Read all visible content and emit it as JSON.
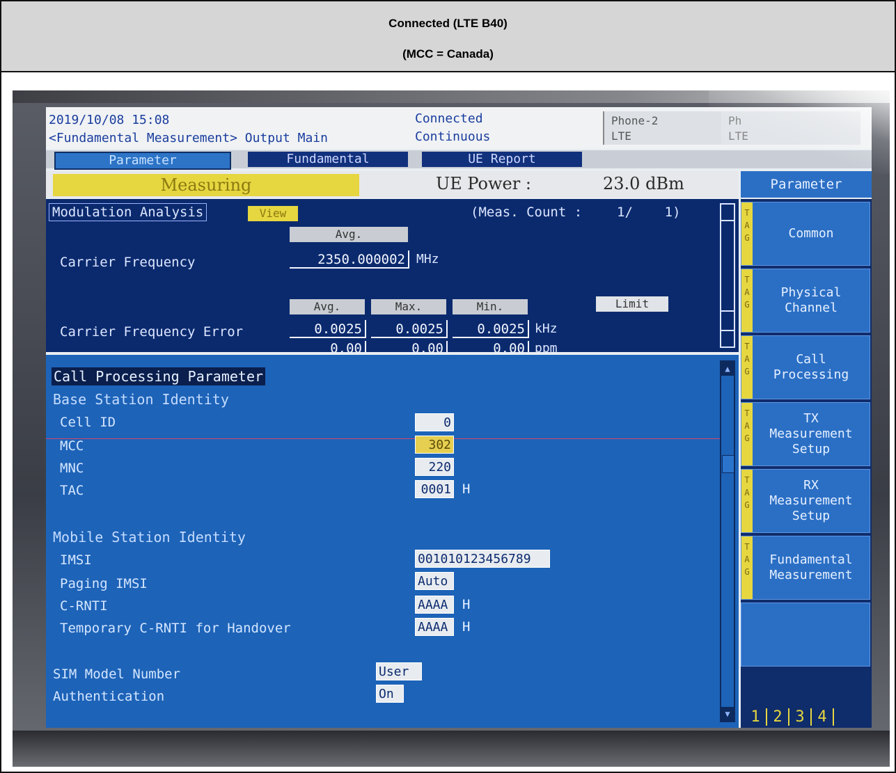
{
  "caption": {
    "line1": "Connected (LTE B40)",
    "line2": "(MCC = Canada)"
  },
  "header": {
    "datetime": "2019/10/08 15:08",
    "breadcrumb": "<Fundamental Measurement> Output Main",
    "status": "Connected",
    "mode": "Continuous",
    "phone2_name": "Phone-2",
    "phone2_tech": "LTE",
    "phone3_name": "Ph",
    "phone3_tech": "LTE"
  },
  "tabs": [
    {
      "label": "Parameter",
      "active": true
    },
    {
      "label": "Fundamental",
      "active": false
    },
    {
      "label": "UE Report",
      "active": false
    }
  ],
  "measure": {
    "state": "Measuring",
    "ue_power_label": "UE Power :",
    "ue_power_value": "23.0 dBm"
  },
  "modulation": {
    "title": "Modulation Analysis",
    "view_button": "View",
    "count_label": "(Meas. Count :",
    "count_value": "1/    1)",
    "avg_label": "Avg.",
    "max_label": "Max.",
    "min_label": "Min.",
    "limit_button": "Limit",
    "carrier_freq_label": "Carrier Frequency",
    "carrier_freq_value": "2350.000002",
    "carrier_freq_unit": "MHz",
    "cfe_label": "Carrier Frequency Error",
    "cfe_avg": "0.0025",
    "cfe_max": "0.0025",
    "cfe_min": "0.0025",
    "cfe_unit": "kHz",
    "ppm_avg": "0.00",
    "ppm_max": "0.00",
    "ppm_min": "0.00",
    "ppm_unit": "ppm"
  },
  "callproc": {
    "heading": "Call Processing Parameter",
    "bs_identity": "Base Station Identity",
    "cell_id_label": "Cell ID",
    "cell_id_value": "0",
    "mcc_label": "MCC",
    "mcc_value": "302",
    "mnc_label": "MNC",
    "mnc_value": "220",
    "tac_label": "TAC",
    "tac_value": "0001",
    "hex_unit": "H",
    "ms_identity": "Mobile Station Identity",
    "imsi_label": "IMSI",
    "imsi_value": "001010123456789",
    "paging_imsi_label": "Paging IMSI",
    "paging_imsi_value": "Auto",
    "crnti_label": "C-RNTI",
    "crnti_value": "AAAA",
    "temp_crnti_label": "Temporary C-RNTI for Handover",
    "temp_crnti_value": "AAAA",
    "sim_model_label": "SIM Model Number",
    "sim_model_value": "User",
    "auth_label": "Authentication",
    "auth_value": "On"
  },
  "menu": {
    "header": "Parameter",
    "tag_letters": "T\nA\nG",
    "items": [
      "Common",
      "Physical\nChannel",
      "Call\nProcessing",
      "TX\nMeasurement\nSetup",
      "RX\nMeasurement\nSetup",
      "Fundamental\nMeasurement",
      ""
    ],
    "pages": [
      "1",
      "2",
      "3",
      "4"
    ]
  }
}
